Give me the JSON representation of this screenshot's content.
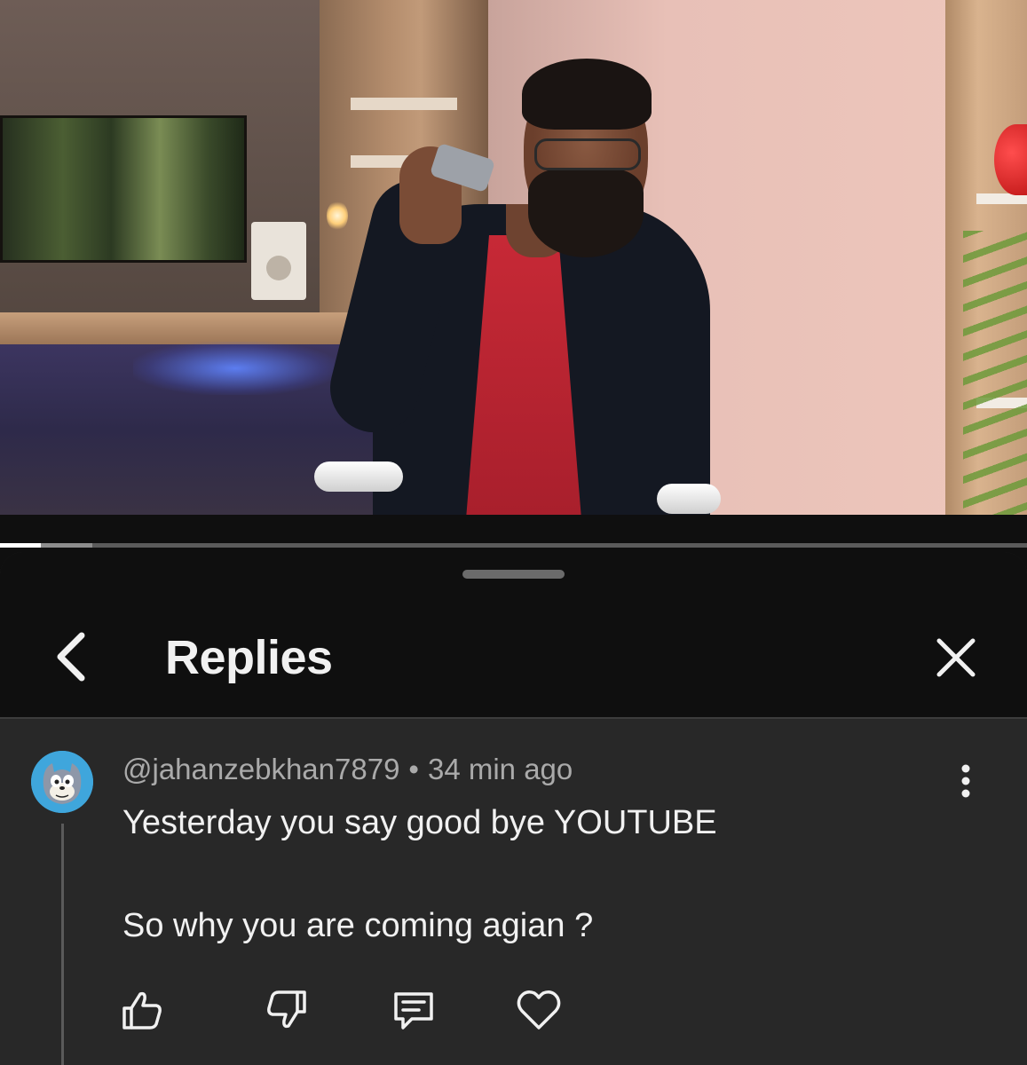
{
  "sheet": {
    "title": "Replies",
    "back_icon": "chevron-left-icon",
    "close_icon": "close-icon"
  },
  "video": {
    "progress_fraction": 0.04,
    "buffered_fraction": 0.09
  },
  "comment": {
    "author": "@jahanzebkhan7879",
    "separator": "•",
    "time": "34 min ago",
    "lines": [
      "Yesterday you say good bye YOUTUBE",
      "So why you are coming agian ?"
    ],
    "actions": [
      "like-icon",
      "dislike-icon",
      "reply-icon",
      "heart-icon"
    ],
    "more_icon": "more-vertical-icon"
  },
  "colors": {
    "sheet_bg": "#282828",
    "header_bg": "#0f0f0f",
    "avatar_bg": "#3fa6dc"
  }
}
